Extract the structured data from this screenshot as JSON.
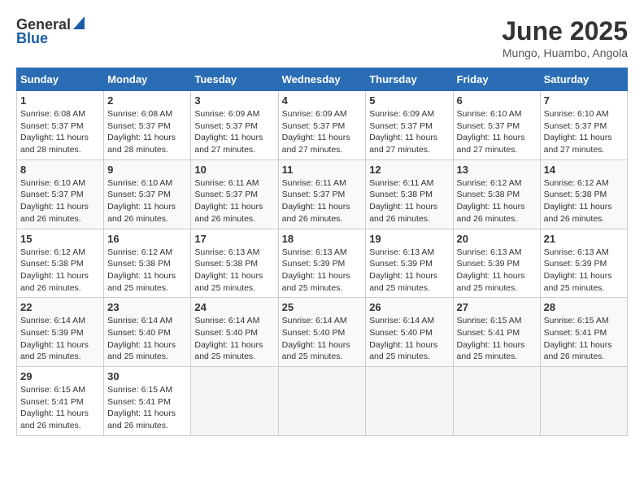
{
  "logo": {
    "general": "General",
    "blue": "Blue"
  },
  "title": {
    "month_year": "June 2025",
    "location": "Mungo, Huambo, Angola"
  },
  "calendar": {
    "headers": [
      "Sunday",
      "Monday",
      "Tuesday",
      "Wednesday",
      "Thursday",
      "Friday",
      "Saturday"
    ],
    "weeks": [
      [
        {
          "day": "",
          "empty": true
        },
        {
          "day": "",
          "empty": true
        },
        {
          "day": "",
          "empty": true
        },
        {
          "day": "",
          "empty": true
        },
        {
          "day": "",
          "empty": true
        },
        {
          "day": "",
          "empty": true
        },
        {
          "day": "",
          "empty": true
        }
      ]
    ],
    "days": [
      {
        "date": "1",
        "sunrise": "6:08 AM",
        "sunset": "5:37 PM",
        "daylight": "11 hours and 28 minutes."
      },
      {
        "date": "2",
        "sunrise": "6:08 AM",
        "sunset": "5:37 PM",
        "daylight": "11 hours and 28 minutes."
      },
      {
        "date": "3",
        "sunrise": "6:09 AM",
        "sunset": "5:37 PM",
        "daylight": "11 hours and 27 minutes."
      },
      {
        "date": "4",
        "sunrise": "6:09 AM",
        "sunset": "5:37 PM",
        "daylight": "11 hours and 27 minutes."
      },
      {
        "date": "5",
        "sunrise": "6:09 AM",
        "sunset": "5:37 PM",
        "daylight": "11 hours and 27 minutes."
      },
      {
        "date": "6",
        "sunrise": "6:10 AM",
        "sunset": "5:37 PM",
        "daylight": "11 hours and 27 minutes."
      },
      {
        "date": "7",
        "sunrise": "6:10 AM",
        "sunset": "5:37 PM",
        "daylight": "11 hours and 27 minutes."
      },
      {
        "date": "8",
        "sunrise": "6:10 AM",
        "sunset": "5:37 PM",
        "daylight": "11 hours and 26 minutes."
      },
      {
        "date": "9",
        "sunrise": "6:10 AM",
        "sunset": "5:37 PM",
        "daylight": "11 hours and 26 minutes."
      },
      {
        "date": "10",
        "sunrise": "6:11 AM",
        "sunset": "5:37 PM",
        "daylight": "11 hours and 26 minutes."
      },
      {
        "date": "11",
        "sunrise": "6:11 AM",
        "sunset": "5:37 PM",
        "daylight": "11 hours and 26 minutes."
      },
      {
        "date": "12",
        "sunrise": "6:11 AM",
        "sunset": "5:38 PM",
        "daylight": "11 hours and 26 minutes."
      },
      {
        "date": "13",
        "sunrise": "6:12 AM",
        "sunset": "5:38 PM",
        "daylight": "11 hours and 26 minutes."
      },
      {
        "date": "14",
        "sunrise": "6:12 AM",
        "sunset": "5:38 PM",
        "daylight": "11 hours and 26 minutes."
      },
      {
        "date": "15",
        "sunrise": "6:12 AM",
        "sunset": "5:38 PM",
        "daylight": "11 hours and 26 minutes."
      },
      {
        "date": "16",
        "sunrise": "6:12 AM",
        "sunset": "5:38 PM",
        "daylight": "11 hours and 25 minutes."
      },
      {
        "date": "17",
        "sunrise": "6:13 AM",
        "sunset": "5:38 PM",
        "daylight": "11 hours and 25 minutes."
      },
      {
        "date": "18",
        "sunrise": "6:13 AM",
        "sunset": "5:39 PM",
        "daylight": "11 hours and 25 minutes."
      },
      {
        "date": "19",
        "sunrise": "6:13 AM",
        "sunset": "5:39 PM",
        "daylight": "11 hours and 25 minutes."
      },
      {
        "date": "20",
        "sunrise": "6:13 AM",
        "sunset": "5:39 PM",
        "daylight": "11 hours and 25 minutes."
      },
      {
        "date": "21",
        "sunrise": "6:13 AM",
        "sunset": "5:39 PM",
        "daylight": "11 hours and 25 minutes."
      },
      {
        "date": "22",
        "sunrise": "6:14 AM",
        "sunset": "5:39 PM",
        "daylight": "11 hours and 25 minutes."
      },
      {
        "date": "23",
        "sunrise": "6:14 AM",
        "sunset": "5:40 PM",
        "daylight": "11 hours and 25 minutes."
      },
      {
        "date": "24",
        "sunrise": "6:14 AM",
        "sunset": "5:40 PM",
        "daylight": "11 hours and 25 minutes."
      },
      {
        "date": "25",
        "sunrise": "6:14 AM",
        "sunset": "5:40 PM",
        "daylight": "11 hours and 25 minutes."
      },
      {
        "date": "26",
        "sunrise": "6:14 AM",
        "sunset": "5:40 PM",
        "daylight": "11 hours and 25 minutes."
      },
      {
        "date": "27",
        "sunrise": "6:15 AM",
        "sunset": "5:41 PM",
        "daylight": "11 hours and 25 minutes."
      },
      {
        "date": "28",
        "sunrise": "6:15 AM",
        "sunset": "5:41 PM",
        "daylight": "11 hours and 26 minutes."
      },
      {
        "date": "29",
        "sunrise": "6:15 AM",
        "sunset": "5:41 PM",
        "daylight": "11 hours and 26 minutes."
      },
      {
        "date": "30",
        "sunrise": "6:15 AM",
        "sunset": "5:41 PM",
        "daylight": "11 hours and 26 minutes."
      }
    ],
    "start_day": 0,
    "labels": {
      "sunrise": "Sunrise: ",
      "sunset": "Sunset: ",
      "daylight": "Daylight: "
    }
  }
}
